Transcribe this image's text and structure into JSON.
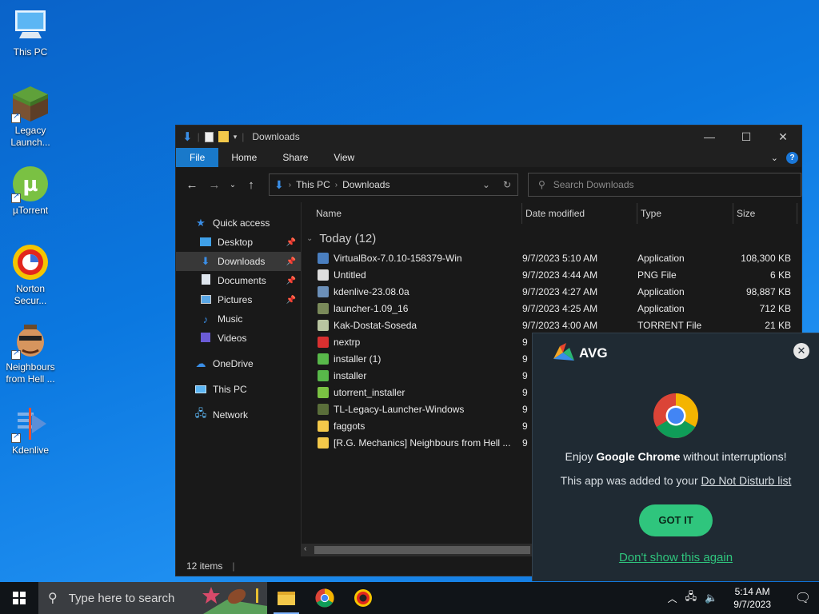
{
  "desktop": {
    "icons": [
      {
        "label": "This PC"
      },
      {
        "label": "Legacy Launch..."
      },
      {
        "label": "µTorrent"
      },
      {
        "label": "Norton Secur..."
      },
      {
        "label": "Neighbours from Hell ..."
      },
      {
        "label": "Kdenlive"
      }
    ]
  },
  "explorer": {
    "title": "Downloads",
    "ribbon": {
      "file": "File",
      "home": "Home",
      "share": "Share",
      "view": "View",
      "help": "?"
    },
    "address": {
      "root": "This PC",
      "current": "Downloads"
    },
    "search_placeholder": "Search Downloads",
    "nav": {
      "quick_access": "Quick access",
      "desktop": "Desktop",
      "downloads": "Downloads",
      "documents": "Documents",
      "pictures": "Pictures",
      "music": "Music",
      "videos": "Videos",
      "onedrive": "OneDrive",
      "thispc": "This PC",
      "network": "Network"
    },
    "columns": {
      "name": "Name",
      "date": "Date modified",
      "type": "Type",
      "size": "Size"
    },
    "group": "Today (12)",
    "files": [
      {
        "name": "VirtualBox-7.0.10-158379-Win",
        "date": "9/7/2023 5:10 AM",
        "type": "Application",
        "size": "108,300 KB",
        "icon": "virtualbox-icon",
        "color": "#4a7fc0"
      },
      {
        "name": "Untitled",
        "date": "9/7/2023 4:44 AM",
        "type": "PNG File",
        "size": "6 KB",
        "icon": "png-file-icon",
        "color": "#dddddd"
      },
      {
        "name": "kdenlive-23.08.0a",
        "date": "9/7/2023 4:27 AM",
        "type": "Application",
        "size": "98,887 KB",
        "icon": "kdenlive-icon",
        "color": "#6b8fb8"
      },
      {
        "name": "launcher-1.09_16",
        "date": "9/7/2023 4:25 AM",
        "type": "Application",
        "size": "712 KB",
        "icon": "launcher-icon",
        "color": "#7a8a5a"
      },
      {
        "name": "Kak-Dostat-Soseda",
        "date": "9/7/2023 4:00 AM",
        "type": "TORRENT File",
        "size": "21 KB",
        "icon": "torrent-file-icon",
        "color": "#b8c4a0"
      },
      {
        "name": "nextrp",
        "date": "9",
        "type": "",
        "size": "",
        "icon": "nextrp-icon",
        "color": "#d83030"
      },
      {
        "name": "installer (1)",
        "date": "9",
        "type": "",
        "size": "",
        "icon": "installer-icon",
        "color": "#58b84a"
      },
      {
        "name": "installer",
        "date": "9",
        "type": "",
        "size": "",
        "icon": "installer-icon",
        "color": "#58b84a"
      },
      {
        "name": "utorrent_installer",
        "date": "9",
        "type": "",
        "size": "",
        "icon": "utorrent-icon",
        "color": "#7ac143"
      },
      {
        "name": "TL-Legacy-Launcher-Windows",
        "date": "9",
        "type": "",
        "size": "",
        "icon": "legacy-launcher-icon",
        "color": "#5a6e3a"
      },
      {
        "name": "faggots",
        "date": "9",
        "type": "",
        "size": "",
        "icon": "folder-icon",
        "color": "#f3c84a"
      },
      {
        "name": "[R.G. Mechanics] Neighbours from Hell ...",
        "date": "9",
        "type": "",
        "size": "",
        "icon": "folder-icon",
        "color": "#f3c84a"
      }
    ],
    "status": "12 items"
  },
  "avg_popup": {
    "brand": "AVG",
    "message_prefix": "Enjoy ",
    "message_bold": "Google Chrome",
    "message_suffix": " without interruptions!",
    "sub_prefix": "This app was added to your ",
    "sub_link": "Do Not Disturb list",
    "got_it": "GOT IT",
    "dont_show": "Don't show this again"
  },
  "taskbar": {
    "search_placeholder": "Type here to search",
    "time": "5:14 AM",
    "date": "9/7/2023"
  }
}
